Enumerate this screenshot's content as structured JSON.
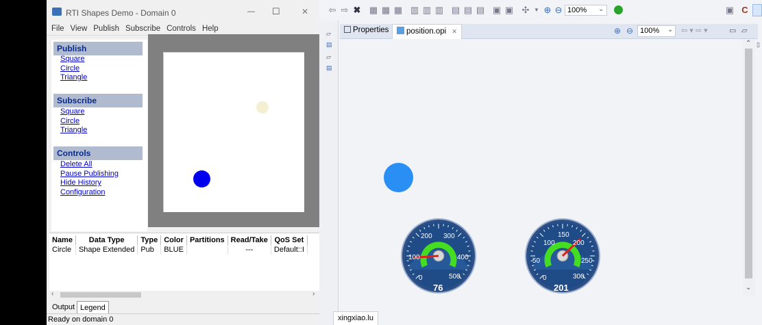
{
  "rti_window": {
    "title": "RTI Shapes Demo - Domain 0",
    "controls": {
      "minimize": "—",
      "maximize": "☐",
      "close": "✕"
    },
    "menu": [
      "File",
      "View",
      "Publish",
      "Subscribe",
      "Controls",
      "Help"
    ],
    "publish": {
      "header": "Publish",
      "items": [
        "Square",
        "Circle",
        "Triangle"
      ]
    },
    "subscribe": {
      "header": "Subscribe",
      "items": [
        "Square",
        "Circle",
        "Triangle"
      ]
    },
    "controls_section": {
      "header": "Controls",
      "items": [
        "Delete All",
        "Pause Publishing",
        "Hide History",
        "Configuration"
      ]
    },
    "table": {
      "headers": [
        "Name",
        "Data Type",
        "Type",
        "Color",
        "Partitions",
        "Read/Take",
        "QoS Set"
      ],
      "rows": [
        [
          "Circle",
          "Shape Extended",
          "Pub",
          "BLUE",
          "",
          "---",
          "Default::I"
        ]
      ]
    },
    "tabs": [
      "Output",
      "Legend"
    ],
    "status": "Ready on domain 0",
    "canvas_shape_color": "#0000ee",
    "history_color": "#f5efd2"
  },
  "eclipse": {
    "tabs": [
      {
        "label": "Properties",
        "icon": "properties-icon"
      },
      {
        "label": "position.opi",
        "icon": "opi-file-icon",
        "close": "✕"
      }
    ],
    "toolbar_zoom": "100%",
    "editor_zoom": "100%",
    "circle_color": "#2a8ff5",
    "bottom_tab": "xingxiao.lu",
    "gauges": [
      {
        "value": 76,
        "ticks": [
          "0",
          "100",
          "200",
          "300",
          "400",
          "500"
        ],
        "min": 0,
        "max": 500
      },
      {
        "value": 201,
        "ticks": [
          "0",
          "50",
          "100",
          "150",
          "200",
          "250",
          "300"
        ],
        "min": 0,
        "max": 300
      }
    ]
  }
}
